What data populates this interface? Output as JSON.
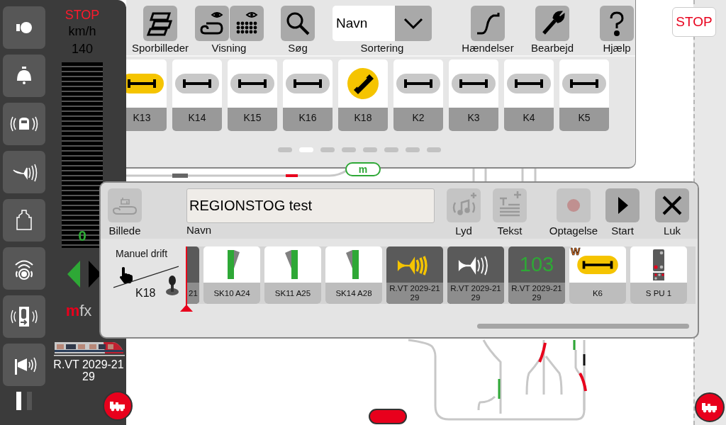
{
  "loco_panel": {
    "stop": "STOP",
    "unit": "km/h",
    "max_speed": "140",
    "speed": "0",
    "forward": false,
    "decoder_mark": "m",
    "decoder_suffix": "fx",
    "loco_name": "R.VT 2029-21 29",
    "functions": [
      {
        "kind": "light"
      },
      {
        "kind": "bell"
      },
      {
        "kind": "train-sound"
      },
      {
        "kind": "horn"
      },
      {
        "kind": "weight"
      },
      {
        "kind": "radio"
      },
      {
        "kind": "door"
      },
      {
        "kind": "megaphone"
      }
    ]
  },
  "toolbar": [
    {
      "kind": "layouts",
      "label": "Sporbilleder"
    },
    {
      "kind": "view",
      "label": "Visning"
    },
    {
      "kind": "search",
      "label": "Søg"
    },
    {
      "kind": "sort",
      "label": "Sortering",
      "value": "Navn"
    },
    {
      "kind": "events",
      "label": "Hændelser"
    },
    {
      "kind": "edit",
      "label": "Bearbejd"
    },
    {
      "kind": "help",
      "label": "Hjælp"
    }
  ],
  "tiles": [
    {
      "kind": "bumper",
      "label": "K13",
      "on": true
    },
    {
      "kind": "bumper",
      "label": "K14",
      "on": false
    },
    {
      "kind": "bumper",
      "label": "K15",
      "on": false
    },
    {
      "kind": "bumper",
      "label": "K16",
      "on": false
    },
    {
      "kind": "disc",
      "label": "K18",
      "on": true
    },
    {
      "kind": "bumper",
      "label": "K2",
      "on": false
    },
    {
      "kind": "bumper",
      "label": "K3",
      "on": false
    },
    {
      "kind": "bumper",
      "label": "K4",
      "on": false
    },
    {
      "kind": "bumper",
      "label": "K5",
      "on": false
    }
  ],
  "pages": [
    {
      "selected": false
    },
    {
      "selected": true
    },
    {
      "selected": false
    },
    {
      "selected": false
    },
    {
      "selected": false
    },
    {
      "selected": false
    },
    {
      "selected": false
    },
    {
      "selected": false
    }
  ],
  "track": {
    "label": "m"
  },
  "stop_button": "STOP",
  "dialog": {
    "image_label": "Billede",
    "image_disabled": true,
    "name": "REGIONSTOG test",
    "name_label": "Navn",
    "buttons": [
      {
        "kind": "sound",
        "label": "Lyd",
        "disabled": true
      },
      {
        "kind": "text",
        "label": "Tekst",
        "disabled": true
      },
      {
        "kind": "record",
        "label": "Optagelse",
        "disabled": true
      },
      {
        "kind": "start",
        "label": "Start",
        "disabled": false
      },
      {
        "kind": "close",
        "label": "Luk",
        "disabled": false
      }
    ],
    "trigger": {
      "mode": "Manuel drift",
      "article": "K18"
    },
    "steps": [
      {
        "kind": "partial",
        "label": "21"
      },
      {
        "kind": "turnout",
        "label": "SK10 A24",
        "flipped": false
      },
      {
        "kind": "turnout",
        "label": "SK11 A25",
        "flipped": true
      },
      {
        "kind": "turnout",
        "label": "SK14 A28",
        "flipped": true
      },
      {
        "kind": "horn",
        "label": "R.VT 2029-21 29",
        "on": true
      },
      {
        "kind": "horn",
        "label": "R.VT 2029-21 29",
        "on": false
      },
      {
        "kind": "value",
        "label": "R.VT 2029-21 29",
        "value": "103"
      },
      {
        "kind": "bumper",
        "label": "K6",
        "on": true,
        "badge": "W"
      },
      {
        "kind": "signal",
        "label": "S PU 1"
      }
    ]
  }
}
